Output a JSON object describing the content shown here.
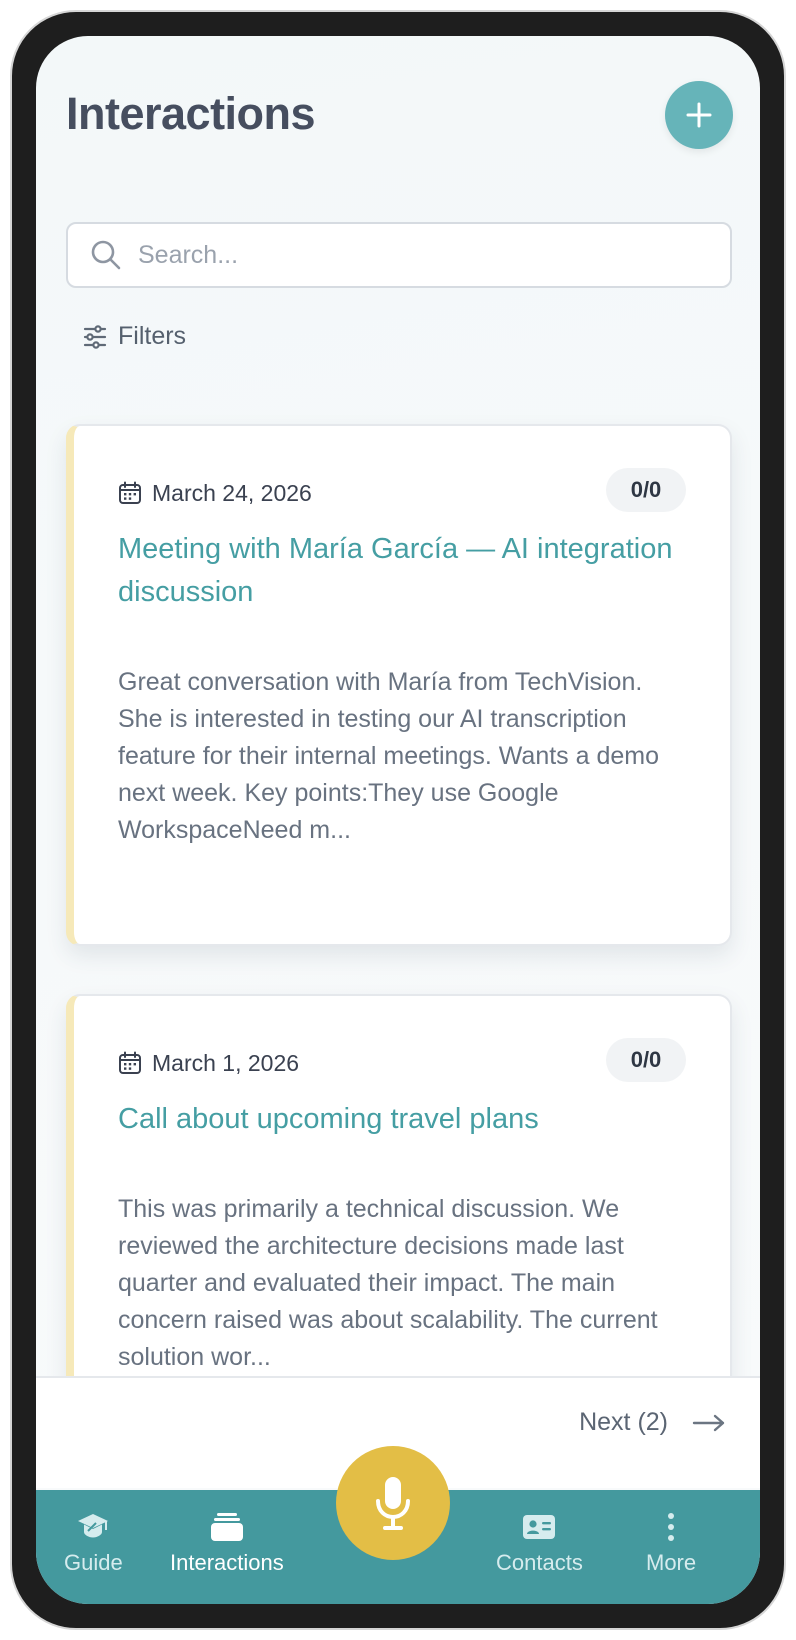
{
  "header": {
    "title": "Interactions",
    "add_label": "+"
  },
  "search": {
    "placeholder": "Search..."
  },
  "filters": {
    "label": "Filters"
  },
  "interactions": [
    {
      "date": "March 24, 2026",
      "count": "0/0",
      "title": "Meeting with María García — AI integration discussion",
      "summary": "Great conversation with María from TechVision. She is interested in testing our AI transcription feature for their internal meetings. Wants a demo next week. Key points:They use Google WorkspaceNeed m..."
    },
    {
      "date": "March 1, 2026",
      "count": "0/0",
      "title": "Call about upcoming travel plans",
      "summary": "This was primarily a technical discussion. We reviewed the architecture decisions made last quarter and evaluated their impact. The main concern raised was about scalability. The current solution wor..."
    }
  ],
  "pager": {
    "next_label": "Next (2)"
  },
  "nav": {
    "items": [
      {
        "label": "Guide",
        "icon": "graduation-cap-icon"
      },
      {
        "label": "Interactions",
        "icon": "inbox-stack-icon",
        "active": true
      },
      {
        "label": "Contacts",
        "icon": "id-card-icon"
      },
      {
        "label": "More",
        "icon": "vertical-dots-icon"
      }
    ],
    "mic_icon": "microphone-icon"
  },
  "colors": {
    "accent": "#44999e",
    "add_button": "#66b4b9",
    "mic_button": "#e3be46",
    "card_title": "#459ea3",
    "card_accent": "#f6e9b9"
  }
}
